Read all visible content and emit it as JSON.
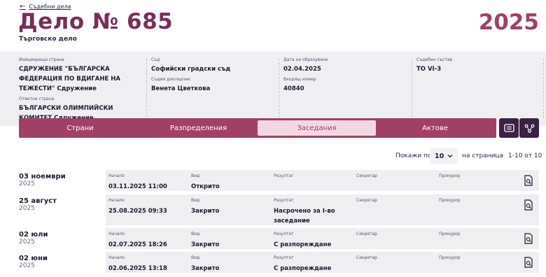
{
  "header": {
    "back_label": "Съдебни дела",
    "title": "Дело № 685",
    "subtitle": "Търговско дело",
    "year": "2025"
  },
  "info": {
    "initiator_label": "Инициираща страна",
    "initiator_value": "СДРУЖЕНИЕ \"БЪЛГАРСКА ФЕДЕРАЦИЯ ПО ВДИГАНЕ НА ТЕЖЕСТИ\" Сдружение",
    "respondent_label": "Ответна страна",
    "respondent_value": "БЪЛГАРСКИ ОЛИМПИЙСКИ КОМИТЕТ Сдружение",
    "court_label": "Съд",
    "court_value": "Софийски градски съд",
    "judge_label": "Съдия докладчик",
    "judge_value": "Венета Цветкова",
    "created_label": "Дата на образуване",
    "created_value": "02.04.2025",
    "incoming_label": "Входящ номер",
    "incoming_value": "40840",
    "panel_label": "Съдебен състав",
    "panel_value": "TO VI-3"
  },
  "tabs": [
    "Страни",
    "Разпределения",
    "Заседания",
    "Актове"
  ],
  "active_tab": 2,
  "icons": {
    "list": "list-view-icon",
    "tree": "hierarchy-icon",
    "document": "document-search-icon"
  },
  "pager": {
    "show_label": "Покажи по",
    "per_page": "10",
    "per_page_suffix": "на страница",
    "range": "1-10 от 10"
  },
  "columns": {
    "start": "Начало",
    "type": "Вид",
    "result": "Резултат",
    "secretary": "Секретар",
    "prosecutor": "Прокурор"
  },
  "sessions": [
    {
      "day": "03 ноември",
      "year": "2025",
      "start": "03.11.2025 11:00",
      "type": "Открито",
      "result": "",
      "secretary": "",
      "prosecutor": ""
    },
    {
      "day": "25 август",
      "year": "2025",
      "start": "25.08.2025 09:33",
      "type": "Закрито",
      "result": "Насрочено за I-во заседание",
      "secretary": "",
      "prosecutor": ""
    },
    {
      "day": "02 юли",
      "year": "2025",
      "start": "02.07.2025 18:26",
      "type": "Закрито",
      "result": "С разпореждане",
      "secretary": "",
      "prosecutor": ""
    },
    {
      "day": "02 юни",
      "year": "2025",
      "start": "02.06.2025 13:18",
      "type": "Закрито",
      "result": "С разпореждане",
      "secretary": "",
      "prosecutor": ""
    }
  ],
  "colors": {
    "brand": "#a23f67",
    "brand_dark": "#3a2342",
    "title": "#7a2d57",
    "panel": "#efeff2",
    "tab_active": "#f3d7e1"
  }
}
